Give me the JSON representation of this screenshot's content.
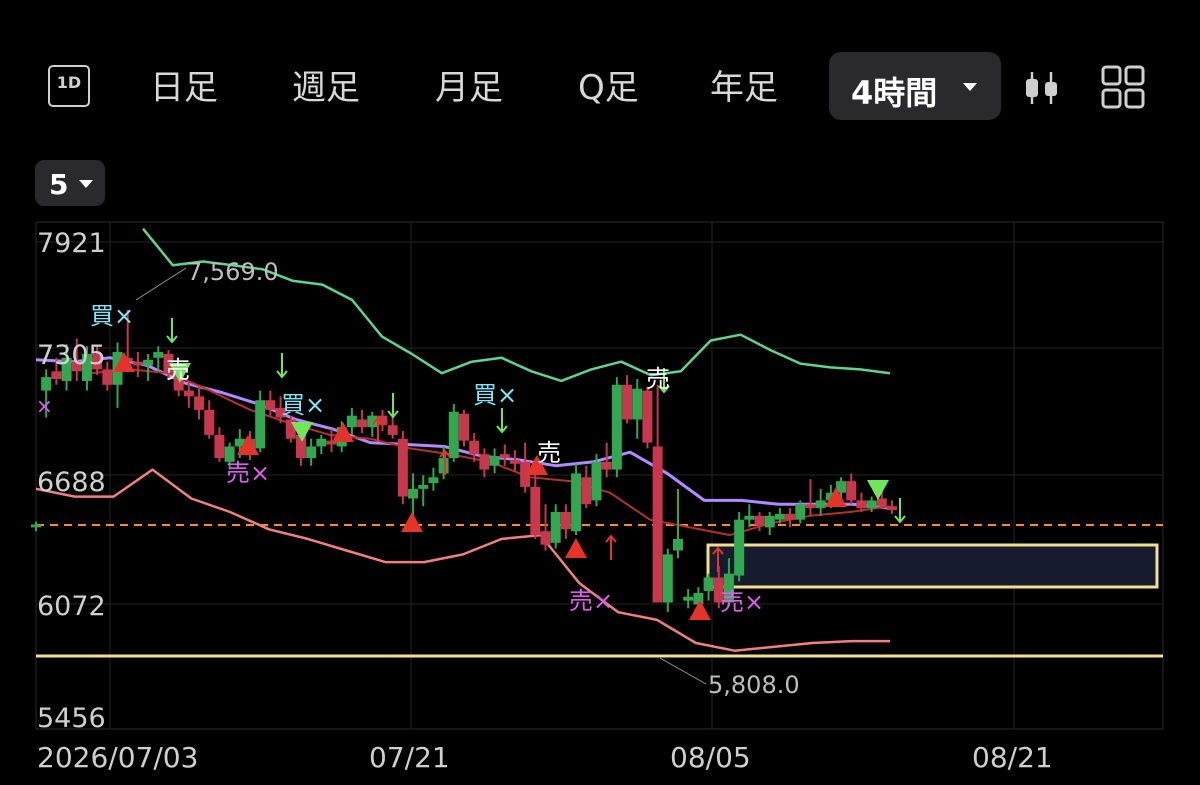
{
  "toolbar": {
    "icon_1d": "1D",
    "tabs": [
      "日足",
      "週足",
      "月足",
      "Q足",
      "年足"
    ],
    "selected_interval": "4時間",
    "candle_icon": "candlestick-icon",
    "layout_icon": "grid-layout-icon"
  },
  "period_selector": {
    "value": "5"
  },
  "chart_data": {
    "type": "candlestick",
    "y_ticks": [
      "7921",
      "7305",
      "6688",
      "6072",
      "5456"
    ],
    "x_ticks": [
      "2026/07/03",
      "07/21",
      "08/05",
      "08/21"
    ],
    "high_label": "7,569.0",
    "low_label": "5,808.0",
    "ylim": [
      5456,
      7921
    ],
    "signals": {
      "buy": "買×",
      "sell": "売×",
      "sell_plain": "売"
    },
    "colors": {
      "up": "#2fa84f",
      "down": "#c8374b",
      "upper_band": "#5ed48c",
      "lower_band": "#f08080",
      "mid_line": "#b28aff",
      "ma_line": "#b82e2e",
      "dashed_level": "#ff8c1a",
      "support": "#f2e08f",
      "buy_text": "#7ee8fa",
      "sell_text": "#e05cf0"
    },
    "candles": [
      [
        6440,
        6470,
        6420,
        6455
      ],
      [
        7150,
        7260,
        7010,
        7220
      ],
      [
        7250,
        7320,
        7180,
        7210
      ],
      [
        7200,
        7390,
        7150,
        7320
      ],
      [
        7300,
        7420,
        7200,
        7250
      ],
      [
        7200,
        7380,
        7150,
        7340
      ],
      [
        7340,
        7380,
        7230,
        7260
      ],
      [
        7260,
        7300,
        7150,
        7180
      ],
      [
        7180,
        7400,
        7060,
        7350
      ],
      [
        7320,
        7569,
        7280,
        7300
      ],
      [
        7300,
        7350,
        7220,
        7280
      ],
      [
        7280,
        7340,
        7200,
        7310
      ],
      [
        7320,
        7380,
        7250,
        7350
      ],
      [
        7340,
        7360,
        7210,
        7240
      ],
      [
        7250,
        7280,
        7120,
        7150
      ],
      [
        7150,
        7200,
        7060,
        7120
      ],
      [
        7120,
        7180,
        7000,
        7050
      ],
      [
        7050,
        7100,
        6900,
        6920
      ],
      [
        6920,
        6960,
        6780,
        6800
      ],
      [
        6780,
        6880,
        6740,
        6860
      ],
      [
        6860,
        6950,
        6800,
        6900
      ],
      [
        6900,
        6940,
        6790,
        6840
      ],
      [
        6850,
        7150,
        6830,
        7100
      ],
      [
        7100,
        7150,
        7020,
        7050
      ],
      [
        7060,
        7120,
        6980,
        7010
      ],
      [
        7000,
        7020,
        6880,
        6900
      ],
      [
        6920,
        6980,
        6760,
        6800
      ],
      [
        6800,
        6900,
        6760,
        6860
      ],
      [
        6860,
        6920,
        6820,
        6900
      ],
      [
        6890,
        6950,
        6830,
        6870
      ],
      [
        6860,
        6990,
        6830,
        6960
      ],
      [
        6960,
        7060,
        6920,
        7020
      ],
      [
        7000,
        7050,
        6930,
        6960
      ],
      [
        6960,
        7040,
        6910,
        7020
      ],
      [
        7020,
        7050,
        6940,
        6970
      ],
      [
        6970,
        7020,
        6900,
        6920
      ],
      [
        6900,
        6940,
        6560,
        6600
      ],
      [
        6590,
        6720,
        6460,
        6640
      ],
      [
        6640,
        6710,
        6550,
        6660
      ],
      [
        6670,
        6750,
        6630,
        6700
      ],
      [
        6720,
        6860,
        6690,
        6800
      ],
      [
        6800,
        7080,
        6780,
        7040
      ],
      [
        7030,
        7050,
        6860,
        6890
      ],
      [
        6890,
        6930,
        6780,
        6820
      ],
      [
        6820,
        6850,
        6700,
        6740
      ],
      [
        6760,
        6850,
        6720,
        6810
      ],
      [
        6820,
        6870,
        6760,
        6800
      ],
      [
        6790,
        6840,
        6730,
        6770
      ],
      [
        6780,
        6880,
        6620,
        6650
      ],
      [
        6650,
        6730,
        6380,
        6400
      ],
      [
        6420,
        6560,
        6320,
        6350
      ],
      [
        6360,
        6560,
        6330,
        6520
      ],
      [
        6520,
        6560,
        6380,
        6430
      ],
      [
        6420,
        6770,
        6400,
        6720
      ],
      [
        6700,
        6760,
        6540,
        6560
      ],
      [
        6580,
        6820,
        6550,
        6780
      ],
      [
        6780,
        6880,
        6700,
        6740
      ],
      [
        6740,
        7220,
        6700,
        7180
      ],
      [
        7180,
        7230,
        6980,
        7000
      ],
      [
        7000,
        7210,
        6900,
        7160
      ],
      [
        7150,
        7170,
        6850,
        6880
      ],
      [
        6860,
        7180,
        6050,
        6050
      ],
      [
        6050,
        6330,
        6000,
        6300
      ],
      [
        6320,
        6640,
        6280,
        6380
      ],
      [
        6060,
        6120,
        6020,
        6080
      ],
      [
        6040,
        6130,
        6000,
        6100
      ],
      [
        6110,
        6200,
        6060,
        6180
      ],
      [
        6180,
        6240,
        6020,
        6050
      ],
      [
        6050,
        6280,
        6030,
        6200
      ],
      [
        6190,
        6520,
        6160,
        6480
      ],
      [
        6480,
        6560,
        6440,
        6500
      ],
      [
        6500,
        6520,
        6420,
        6450
      ],
      [
        6440,
        6520,
        6400,
        6500
      ],
      [
        6480,
        6540,
        6460,
        6510
      ],
      [
        6510,
        6540,
        6440,
        6480
      ],
      [
        6480,
        6580,
        6460,
        6560
      ],
      [
        6560,
        6690,
        6500,
        6540
      ],
      [
        6540,
        6640,
        6500,
        6580
      ],
      [
        6580,
        6660,
        6540,
        6620
      ],
      [
        6620,
        6700,
        6560,
        6680
      ],
      [
        6680,
        6720,
        6560,
        6580
      ],
      [
        6580,
        6620,
        6520,
        6540
      ],
      [
        6540,
        6600,
        6520,
        6580
      ],
      [
        6590,
        6630,
        6540,
        6550
      ],
      [
        6550,
        6580,
        6510,
        6530
      ]
    ],
    "upper_band": [
      7990,
      7800,
      7820,
      7800,
      7780,
      7720,
      7700,
      7620,
      7430,
      7340,
      7240,
      7300,
      7320,
      7250,
      7200,
      7260,
      7300,
      7230,
      7250,
      7410,
      7440,
      7360,
      7290,
      7270,
      7260,
      7240
    ],
    "lower_band": [
      6640,
      6600,
      6600,
      6740,
      6590,
      6520,
      6430,
      6380,
      6320,
      6260,
      6260,
      6300,
      6380,
      6400,
      6150,
      6000,
      5960,
      5840,
      5800,
      5820,
      5840,
      5850,
      5850
    ],
    "mid_line": [
      7310,
      7300,
      7320,
      7280,
      7190,
      7140,
      7080,
      7000,
      6950,
      6880,
      6870,
      6860,
      6810,
      6790,
      6760,
      6780,
      6830,
      6720,
      6580,
      6580,
      6560,
      6560,
      6560,
      6540
    ],
    "ma_line": [
      7240,
      7260,
      7240,
      7150,
      7050,
      6980,
      6920,
      6900,
      6850,
      6820,
      6780,
      6700,
      6680,
      6620,
      6480,
      6440,
      6400,
      6460,
      6500,
      6520,
      6550
    ]
  }
}
